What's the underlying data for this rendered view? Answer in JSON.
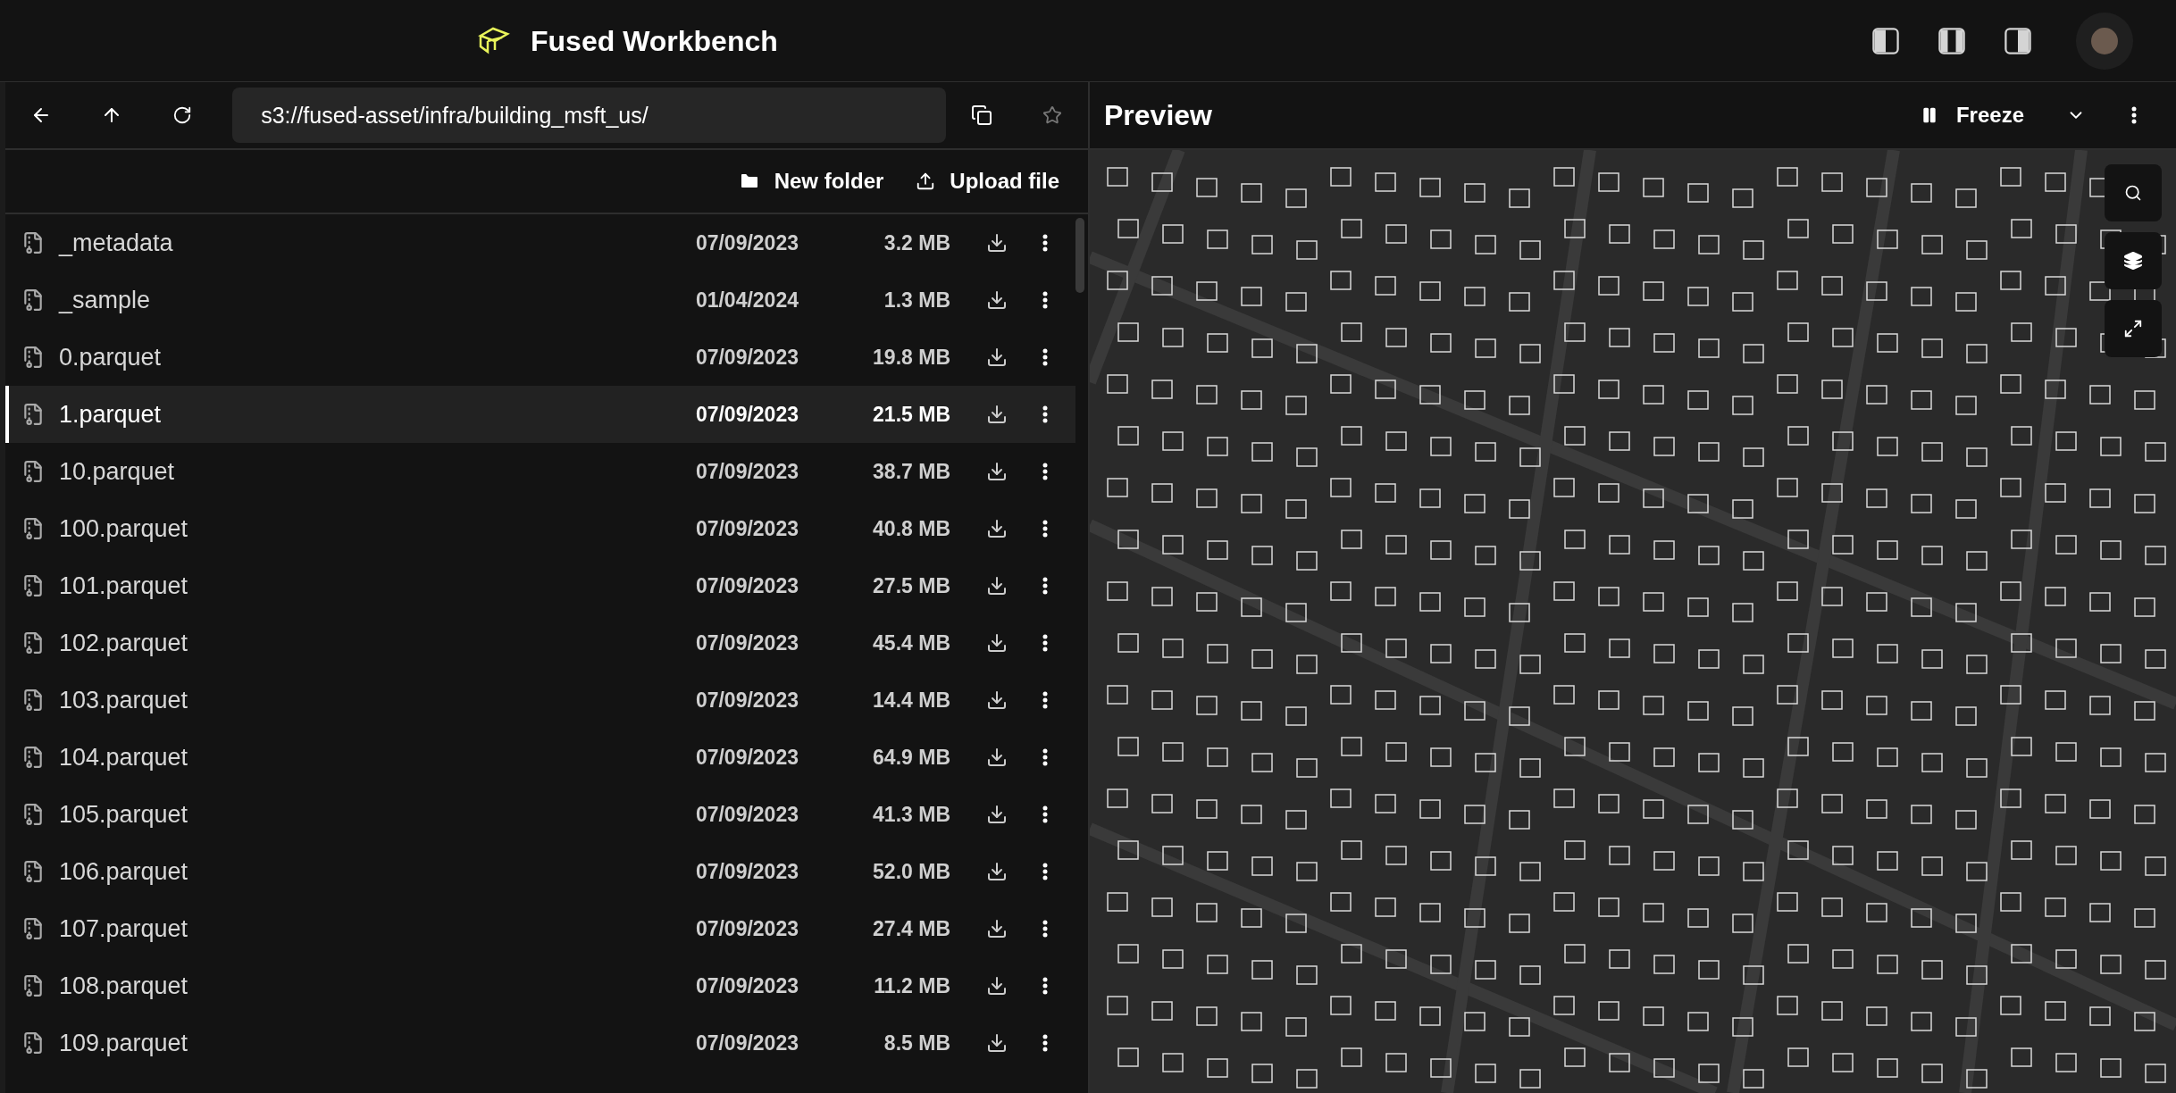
{
  "header": {
    "title": "Fused Workbench"
  },
  "browser": {
    "path": "s3://fused-asset/infra/building_msft_us/",
    "actions": [
      "New folder",
      "Upload file"
    ],
    "files": [
      {
        "name": "_metadata",
        "date": "07/09/2023",
        "size": "3.2 MB",
        "selected": false
      },
      {
        "name": "_sample",
        "date": "01/04/2024",
        "size": "1.3 MB",
        "selected": false
      },
      {
        "name": "0.parquet",
        "date": "07/09/2023",
        "size": "19.8 MB",
        "selected": false
      },
      {
        "name": "1.parquet",
        "date": "07/09/2023",
        "size": "21.5 MB",
        "selected": true
      },
      {
        "name": "10.parquet",
        "date": "07/09/2023",
        "size": "38.7 MB",
        "selected": false
      },
      {
        "name": "100.parquet",
        "date": "07/09/2023",
        "size": "40.8 MB",
        "selected": false
      },
      {
        "name": "101.parquet",
        "date": "07/09/2023",
        "size": "27.5 MB",
        "selected": false
      },
      {
        "name": "102.parquet",
        "date": "07/09/2023",
        "size": "45.4 MB",
        "selected": false
      },
      {
        "name": "103.parquet",
        "date": "07/09/2023",
        "size": "14.4 MB",
        "selected": false
      },
      {
        "name": "104.parquet",
        "date": "07/09/2023",
        "size": "64.9 MB",
        "selected": false
      },
      {
        "name": "105.parquet",
        "date": "07/09/2023",
        "size": "41.3 MB",
        "selected": false
      },
      {
        "name": "106.parquet",
        "date": "07/09/2023",
        "size": "52.0 MB",
        "selected": false
      },
      {
        "name": "107.parquet",
        "date": "07/09/2023",
        "size": "27.4 MB",
        "selected": false
      },
      {
        "name": "108.parquet",
        "date": "07/09/2023",
        "size": "11.2 MB",
        "selected": false
      },
      {
        "name": "109.parquet",
        "date": "07/09/2023",
        "size": "8.5 MB",
        "selected": false
      }
    ]
  },
  "preview": {
    "title": "Preview",
    "freeze_label": "Freeze"
  }
}
